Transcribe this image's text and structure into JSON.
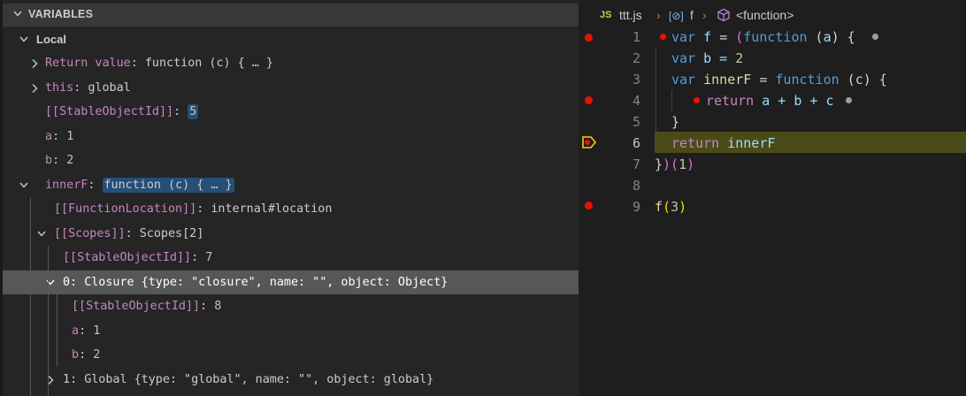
{
  "panel": {
    "title": "VARIABLES",
    "scope_label": "Local"
  },
  "variables": {
    "return_value": {
      "name": "Return value",
      "value": "function (c) { … }"
    },
    "this": {
      "name": "this",
      "value": "global"
    },
    "stable1": {
      "name": "[[StableObjectId]]",
      "value": "5"
    },
    "a": {
      "name": "a",
      "value": "1"
    },
    "b": {
      "name": "b",
      "value": "2"
    },
    "innerF": {
      "name": "innerF",
      "value": "function (c) { … }"
    },
    "fnloc": {
      "name": "[[FunctionLocation]]",
      "value": "internal#location"
    },
    "scopes": {
      "name": "[[Scopes]]",
      "value": "Scopes[2]"
    },
    "stable2": {
      "name": "[[StableObjectId]]",
      "value": "7"
    },
    "closure": {
      "name": "0",
      "value": "Closure {type: \"closure\", name: \"\", object: Object}"
    },
    "stable3": {
      "name": "[[StableObjectId]]",
      "value": "8"
    },
    "a2": {
      "name": "a",
      "value": "1"
    },
    "b2": {
      "name": "b",
      "value": "2"
    },
    "global": {
      "name": "1",
      "value": "Global {type: \"global\", name: \"\", object: global}"
    }
  },
  "editor": {
    "breadcrumb": {
      "file_icon": "JS",
      "file": "ttt.js",
      "symbol_icon": "[⊘]",
      "symbol": "f",
      "function_label": "<function>"
    },
    "lines": [
      "1",
      "2",
      "3",
      "4",
      "5",
      "6",
      "7",
      "8",
      "9"
    ],
    "code": {
      "l1": {
        "kw": "var",
        "id": " f ",
        "eq": "= ",
        "p1": "(",
        "fn": "function",
        "p2": " (",
        "arg": "a",
        "p3": ") {"
      },
      "l2": {
        "kw": "var",
        "rest": " b = ",
        "num": "2"
      },
      "l3": {
        "kw": "var",
        "id": " innerF",
        "eq": " = ",
        "fn": "function",
        "p1": " (",
        "arg": "c",
        "p2": ") {"
      },
      "l4": {
        "kw": "return",
        "rest": " a + b + c"
      },
      "l5": {
        "text": "}"
      },
      "l6": {
        "kw": "return",
        "rest": " innerF"
      },
      "l7": {
        "p1": "}",
        "p2": ")(",
        "num": "1",
        "p3": ")"
      },
      "l9": {
        "fn": "f",
        "p1": "(",
        "num": "3",
        "p2": ")"
      }
    }
  }
}
